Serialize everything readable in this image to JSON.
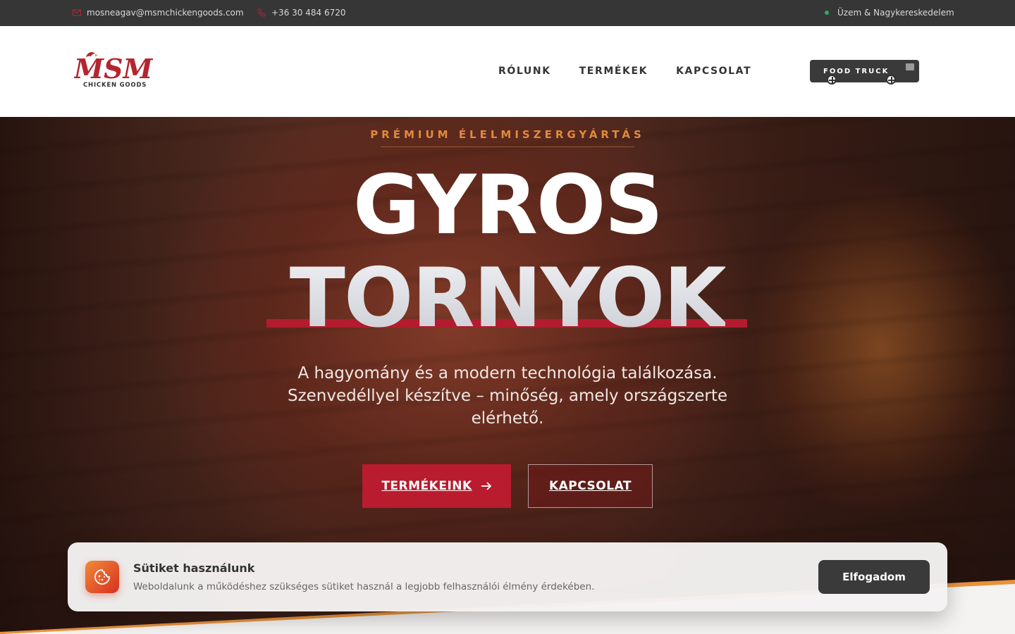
{
  "topbar": {
    "email": "mosneagav@msmchickengoods.com",
    "phone": "+36 30 484 6720",
    "status": "Üzem & Nagykereskedelem"
  },
  "header": {
    "logo_text": "MSM",
    "logo_sub": "CHICKEN GOODS",
    "nav": [
      "RÓLUNK",
      "TERMÉKEK",
      "KAPCSOLAT"
    ],
    "food_truck_label": "FOOD TRUCK"
  },
  "hero": {
    "eyebrow": "PRÉMIUM ÉLELMISZERGYÁRTÁS",
    "title_line1": "GYROS",
    "title_line2": "TORNYOK",
    "subtitle": "A hagyomány és a modern technológia találkozása. Szenvedéllyel készítve – minőség, amely országszerte elérhető.",
    "primary_button": "TERMÉKEINK",
    "secondary_button": "KAPCSOLAT"
  },
  "cookie": {
    "title": "Sütiket használunk",
    "description": "Weboldalunk a működéshez szükséges sütiket használ a legjobb felhasználói élmény érdekében.",
    "accept_label": "Elfogadom"
  },
  "colors": {
    "brand_red": "#b81c2e",
    "accent_orange": "#e08a3c",
    "topbar_bg": "#363636",
    "status_green": "#27ae60"
  },
  "icons": {
    "email": "envelope-icon",
    "phone": "phone-icon",
    "status": "status-dot-icon",
    "cookie": "cookie-icon",
    "arrow": "arrow-right-icon",
    "truck": "food-truck-icon"
  }
}
